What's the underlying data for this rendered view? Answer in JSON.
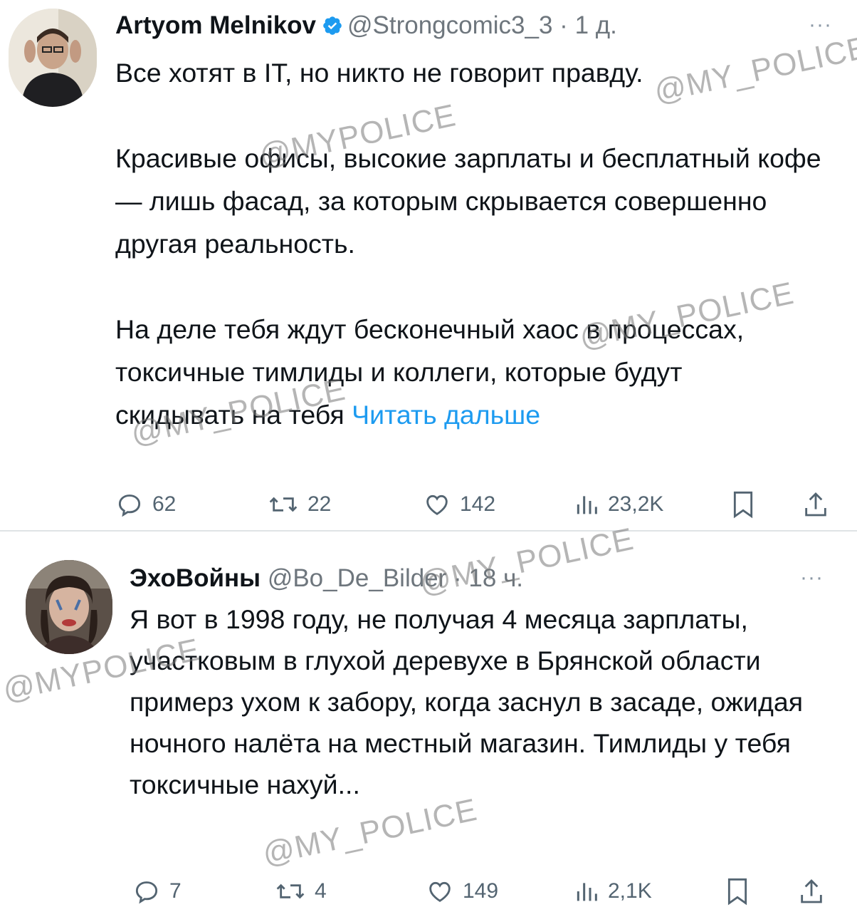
{
  "tweets": [
    {
      "name": "Artyom Melnikov",
      "handle": "@Strongcomic3_3",
      "sep": " · ",
      "time": "1 д.",
      "more": "···",
      "paragraphs": [
        "Все хотят в IT, но никто не говорит правду.",
        "Красивые офисы, высокие зарплаты и бесплатный кофе — лишь фасад, за которым скрывается совершенно другая реальность.",
        "На деле тебя ждут бесконечный хаос в процессах, токсичные тимлиды и коллеги, которые будут скидывать на тебя"
      ],
      "read_more": "Читать дальше",
      "stats": {
        "replies": "62",
        "reposts": "22",
        "likes": "142",
        "views": "23,2K"
      }
    },
    {
      "name": "ЭхоВойны",
      "handle": "@Bo_De_Bilder",
      "sep": " · ",
      "time": "18 ч.",
      "more": "···",
      "text": "Я вот в 1998 году, не получая 4 месяца зарплаты, участковым в глухой деревухе в Брянской области примерз ухом к забору, когда заснул в засаде, ожидая ночного налёта на местный магазин. Тимлиды у тебя токсичные нахуй...",
      "stats": {
        "replies": "7",
        "reposts": "4",
        "likes": "149",
        "views": "2,1K"
      }
    }
  ],
  "watermarks": [
    "@MY_POLICE",
    "@MYPOLICE",
    "@MY_POLICE",
    "@MY_POLICE",
    "@MY_POLICE",
    "@MYPOLICE",
    "@MY_POLICE"
  ],
  "colors": {
    "link": "#1d9bf0",
    "text": "#0f1419",
    "secondary": "#536471",
    "verified": "#1d9bf0"
  },
  "icons": [
    "reply-icon",
    "repost-icon",
    "like-icon",
    "views-icon",
    "bookmark-icon",
    "share-icon",
    "verified-badge-icon",
    "more-icon"
  ]
}
